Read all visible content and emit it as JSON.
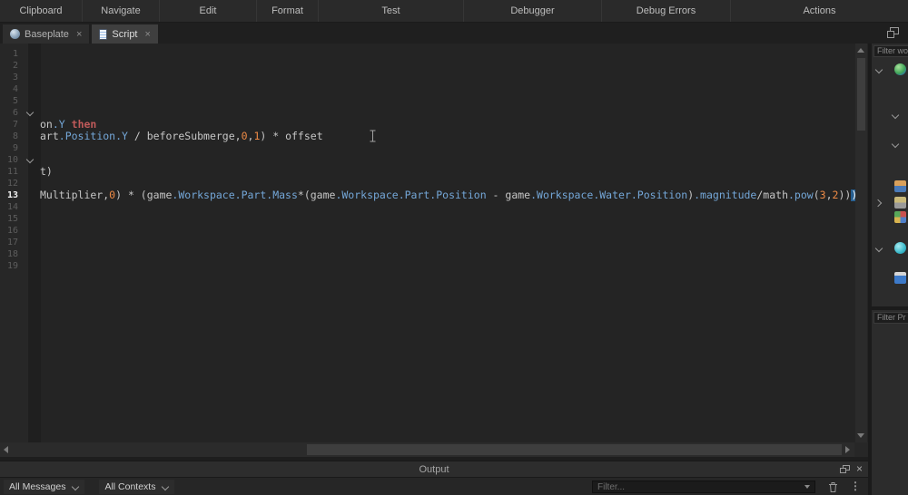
{
  "menu": {
    "items": [
      "Clipboard",
      "Navigate",
      "Edit",
      "Format",
      "Test",
      "Debugger",
      "Debug Errors",
      "Actions"
    ]
  },
  "tabs": {
    "close_glyph": "×",
    "items": [
      {
        "label": "Baseplate",
        "icon": "world-icon",
        "active": false
      },
      {
        "label": "Script",
        "icon": "script-icon",
        "active": true
      }
    ]
  },
  "editor": {
    "colors": {
      "plain": "#c6c6c6",
      "property": "#74a7d8",
      "keyword": "#c05a5a",
      "number": "#ee8a45",
      "bracket_highlight_bg": "#265e8f"
    },
    "lines": [
      {
        "n": "1",
        "tokens": []
      },
      {
        "n": "2",
        "tokens": []
      },
      {
        "n": "3",
        "tokens": []
      },
      {
        "n": "4",
        "tokens": []
      },
      {
        "n": "5",
        "tokens": []
      },
      {
        "n": "6",
        "fold": true,
        "tokens": []
      },
      {
        "n": "7",
        "tokens": [
          [
            "on",
            "p"
          ],
          [
            ".Y",
            "prop"
          ],
          [
            " ",
            "p"
          ],
          [
            "then",
            "kw"
          ]
        ]
      },
      {
        "n": "8",
        "tokens": [
          [
            "art",
            "p"
          ],
          [
            ".Position.Y",
            "prop"
          ],
          [
            " / beforeSubmerge,",
            "p"
          ],
          [
            "0",
            "num"
          ],
          [
            ",",
            "p"
          ],
          [
            "1",
            "num"
          ],
          [
            ") * offset",
            "p"
          ]
        ]
      },
      {
        "n": "9",
        "tokens": []
      },
      {
        "n": "10",
        "fold": true,
        "tokens": []
      },
      {
        "n": "11",
        "tokens": [
          [
            "t)",
            "p"
          ]
        ]
      },
      {
        "n": "12",
        "tokens": []
      },
      {
        "n": "13",
        "current": true,
        "tokens": [
          [
            "Multiplier,",
            "p"
          ],
          [
            "0",
            "num"
          ],
          [
            ") * (game",
            "p"
          ],
          [
            ".Workspace.Part.Mass",
            "prop"
          ],
          [
            "*(game",
            "p"
          ],
          [
            ".Workspace.Part.Position",
            "prop"
          ],
          [
            " - game",
            "p"
          ],
          [
            ".Workspace.Water.Position",
            "prop"
          ],
          [
            ")",
            "p"
          ],
          [
            ".magnitude",
            "prop"
          ],
          [
            "/math",
            "p"
          ],
          [
            ".pow",
            "prop"
          ],
          [
            "(",
            "p"
          ],
          [
            "3",
            "num"
          ],
          [
            ",",
            "p"
          ],
          [
            "2",
            "num"
          ],
          [
            "))",
            "p"
          ],
          [
            ")",
            "hl"
          ]
        ]
      },
      {
        "n": "14",
        "tokens": []
      },
      {
        "n": "15",
        "tokens": []
      },
      {
        "n": "16",
        "tokens": []
      },
      {
        "n": "17",
        "tokens": []
      },
      {
        "n": "18",
        "tokens": []
      },
      {
        "n": "19",
        "tokens": []
      }
    ]
  },
  "explorer": {
    "filter_placeholder": "Filter wo",
    "items": [
      {
        "icon": "workspace-icon",
        "chevron": "down",
        "indent": 0
      },
      {
        "icon": "tree-item-icon",
        "chevron": "down",
        "indent": 1
      },
      {
        "icon": "tree-item-icon",
        "chevron": "down",
        "indent": 1
      },
      {
        "icon": "players-icon",
        "chevron": "none",
        "indent": 0
      },
      {
        "icon": "team-icon",
        "chevron": "right",
        "indent": 0
      },
      {
        "icon": "parts-icon",
        "chevron": "none",
        "indent": 0
      },
      {
        "icon": "sphere-icon",
        "chevron": "down",
        "indent": 0
      },
      {
        "icon": "character-icon",
        "chevron": "none",
        "indent": 0
      }
    ]
  },
  "properties": {
    "filter_placeholder": "Filter Pr"
  },
  "output": {
    "title": "Output"
  },
  "output_toolbar": {
    "messages_filter": "All Messages",
    "context_filter": "All Contexts",
    "filter_placeholder": "Filter..."
  }
}
